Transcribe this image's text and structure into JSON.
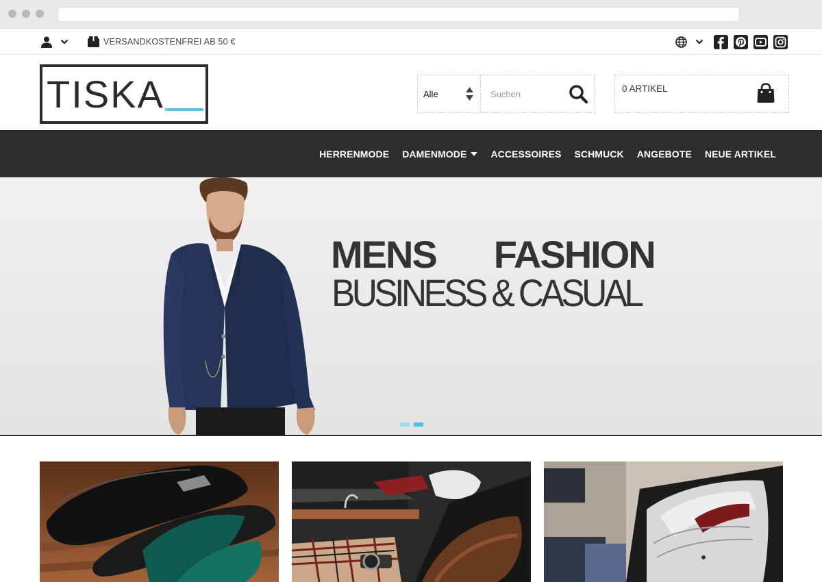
{
  "topbar": {
    "shipping_text": "VERSANDKOSTENFREI AB 50 €",
    "social": [
      "facebook-icon",
      "pinterest-icon",
      "youtube-icon",
      "instagram-icon"
    ]
  },
  "header": {
    "logo_text": "TISKA",
    "search": {
      "category_selected": "Alle",
      "placeholder": "Suchen"
    },
    "cart_label": "0 ARTIKEL"
  },
  "nav": {
    "items": [
      {
        "label": "HERRENMODE"
      },
      {
        "label": "DAMENMODE"
      },
      {
        "label": "ACCESSOIRES"
      },
      {
        "label": "SCHMUCK"
      },
      {
        "label": "ANGEBOTE"
      },
      {
        "label": "NEUE ARTIKEL"
      }
    ]
  },
  "hero": {
    "title_left": "MENS",
    "title_right": "FASHION",
    "subtitle": "BUSINESS & CASUAL"
  },
  "colors": {
    "accent": "#5bc6e9",
    "nav_bg": "#2d2d2d",
    "text_dark": "#2b2b2b"
  }
}
